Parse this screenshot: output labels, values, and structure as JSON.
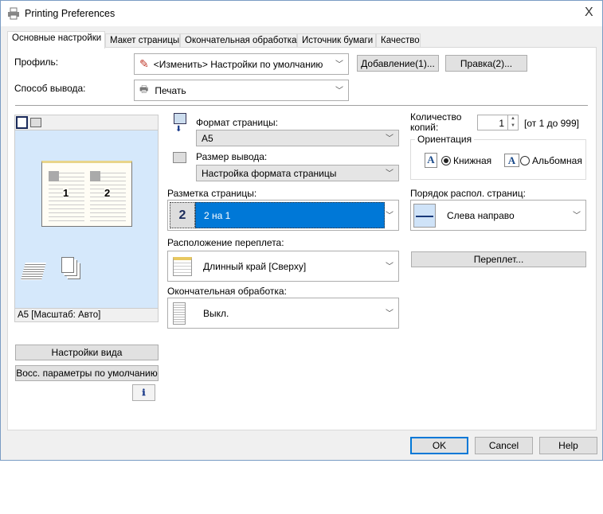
{
  "window": {
    "title": "Printing Preferences",
    "close": "X"
  },
  "tabs": [
    {
      "label": "Основные настройки",
      "active": true
    },
    {
      "label": "Макет страницы"
    },
    {
      "label": "Окончательная обработка"
    },
    {
      "label": "Источник бумаги"
    },
    {
      "label": "Качество"
    }
  ],
  "profile": {
    "label": "Профиль:",
    "value": "<Изменить> Настройки по умолчанию",
    "add_button": "Добавление(1)...",
    "edit_button": "Правка(2)..."
  },
  "output": {
    "label": "Способ вывода:",
    "value": "Печать"
  },
  "preview": {
    "page_numbers": [
      "1",
      "2"
    ],
    "status": "A5 [Масштаб: Авто]",
    "view_settings_button": "Настройки вида",
    "restore_defaults_button": "Восс. параметры по умолчанию"
  },
  "page_size": {
    "label": "Формат страницы:",
    "value": "A5"
  },
  "output_size": {
    "label": "Размер вывода:",
    "value": "Настройка формата страницы"
  },
  "layout": {
    "label": "Разметка страницы:",
    "icon_text": "2",
    "value": "2 на 1"
  },
  "binding": {
    "label": "Расположение переплета:",
    "value": "Длинный край [Сверху]"
  },
  "finishing": {
    "label": "Окончательная обработка:",
    "value": "Выкл."
  },
  "copies": {
    "label": "Количество копий:",
    "value": "1",
    "range": "[от 1 до 999]"
  },
  "orientation": {
    "label": "Ориентация",
    "portrait": "Книжная",
    "landscape": "Альбомная",
    "selected": "portrait"
  },
  "page_order": {
    "label": "Порядок распол. страниц:",
    "value": "Слева направо"
  },
  "binding_button": "Переплет...",
  "footer": {
    "ok": "OK",
    "cancel": "Cancel",
    "help": "Help"
  },
  "colors": {
    "accent": "#0078d7",
    "preview_bg": "#d5e8fb"
  }
}
